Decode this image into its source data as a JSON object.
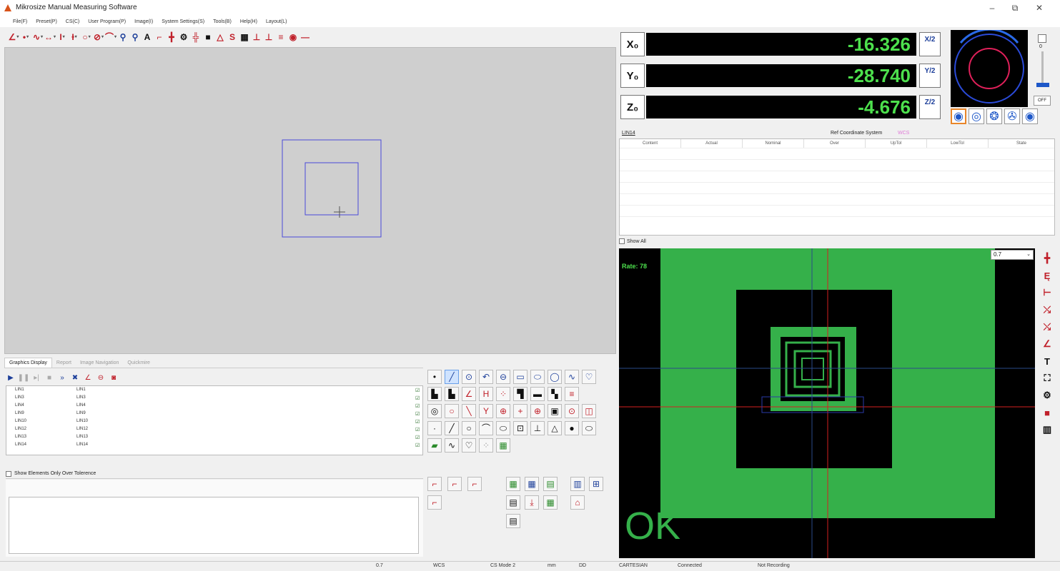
{
  "window": {
    "title": "Mikrosize Manual Measuring Software",
    "controls": [
      "–",
      "⧉",
      "✕"
    ]
  },
  "menu": [
    "File(F)",
    "Preset(P)",
    "CS(C)",
    "User Program(P)",
    "Image(I)",
    "System Settings(S)",
    "Tools(B)",
    "Help(H)",
    "Layout(L)"
  ],
  "tabs": [
    "Graphics Display",
    "Report",
    "Image Navigation",
    "Quickmire"
  ],
  "elements": [
    {
      "name": "LIN1",
      "ref": "LIN1"
    },
    {
      "name": "LIN3",
      "ref": "LIN3"
    },
    {
      "name": "LIN4",
      "ref": "LIN4"
    },
    {
      "name": "LIN9",
      "ref": "LIN9"
    },
    {
      "name": "LIN10",
      "ref": "LIN10"
    },
    {
      "name": "LIN12",
      "ref": "LIN12"
    },
    {
      "name": "LIN13",
      "ref": "LIN13"
    },
    {
      "name": "LIN14",
      "ref": "LIN14"
    }
  ],
  "show_over_tolerance": "Show Elements Only Over Tolerence",
  "dro": {
    "x_label": "X₀",
    "x_value": "-16.326",
    "y_label": "Y₀",
    "y_value": "-28.740",
    "z_label": "Z₀",
    "z_value": "-4.676",
    "x_half": "X/2",
    "y_half": "Y/2",
    "z_half": "Z/2"
  },
  "light": {
    "off_label": "OFF",
    "slider_value": "0"
  },
  "results": {
    "element": "LIN14",
    "ref_cs_label": "Ref Coordinate System",
    "ref_cs_value": "WCS",
    "columns": [
      "Content",
      "Actual",
      "Nominal",
      "Over",
      "UpTol",
      "LowTol",
      "State"
    ],
    "show_all": "Show All"
  },
  "camera": {
    "rate": "Rate: 78",
    "zoom": "0.7",
    "verdict": "OK"
  },
  "status": {
    "zoom": "0.7",
    "cs": "WCS",
    "cs_mode": "CS Mode 2",
    "unit": "mm",
    "angle": "DD",
    "coord": "CARTESIAN",
    "connection": "Connected",
    "recording": "Not Recording"
  },
  "colors": {
    "dro_text": "#4de04d",
    "camera_green": "#35b04a",
    "accent_red": "#c0202a",
    "accent_blue": "#1d3f9a"
  }
}
